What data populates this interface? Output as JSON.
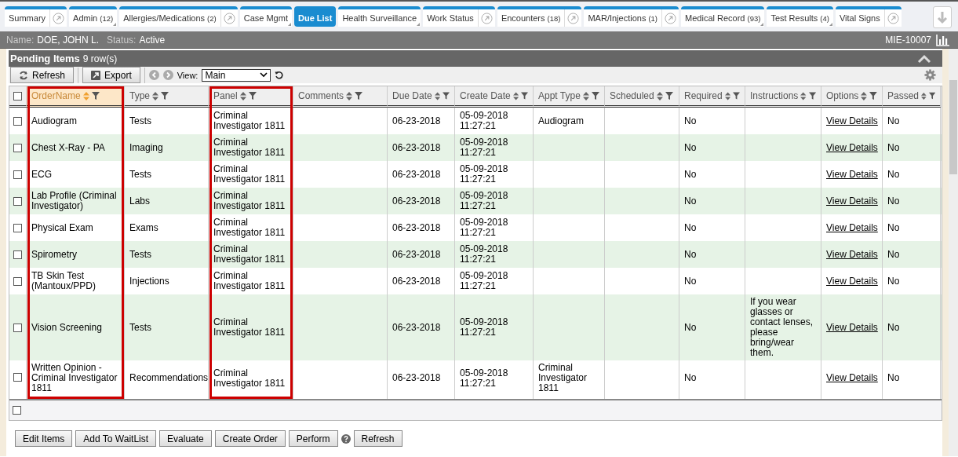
{
  "tabs": [
    {
      "label": "Summary",
      "selected": false,
      "link": true,
      "corner": false
    },
    {
      "label": "Admin",
      "count": "(12)",
      "selected": false,
      "link": false,
      "corner": true
    },
    {
      "label": "Allergies/Medications",
      "count": "(2)",
      "selected": false,
      "link": true,
      "corner": false
    },
    {
      "label": "Case Mgmt",
      "selected": false,
      "link": false,
      "corner": true
    },
    {
      "label": "Due List",
      "selected": true,
      "link": false,
      "corner": false
    },
    {
      "label": "Health Surveillance",
      "selected": false,
      "link": false,
      "corner": true
    },
    {
      "label": "Work Status",
      "selected": false,
      "link": true,
      "corner": false
    },
    {
      "label": "Encounters",
      "count": "(18)",
      "selected": false,
      "link": true,
      "corner": false
    },
    {
      "label": "MAR/Injections",
      "count": "(1)",
      "selected": false,
      "link": true,
      "corner": false
    },
    {
      "label": "Medical Record",
      "count": "(93)",
      "selected": false,
      "link": false,
      "corner": true
    },
    {
      "label": "Test Results",
      "count": "(4)",
      "selected": false,
      "link": false,
      "corner": true
    },
    {
      "label": "Vital Signs",
      "selected": false,
      "link": true,
      "corner": false
    }
  ],
  "patient": {
    "name_label": "Name:",
    "name": "DOE, JOHN L.",
    "status_label": "Status:",
    "status": "Active",
    "id": "MIE-10007"
  },
  "panel": {
    "title": "Pending Items",
    "row_count": "9 row(s)"
  },
  "toolbar": {
    "refresh": "Refresh",
    "export": "Export",
    "view_label": "View:",
    "view": "Main"
  },
  "table": {
    "columns": [
      {
        "label": "OrderName",
        "sorted": true,
        "highlighted": true
      },
      {
        "label": "Type",
        "sorted": false,
        "highlighted": false
      },
      {
        "label": "Panel",
        "sorted": false,
        "highlighted": true
      },
      {
        "label": "Comments",
        "sorted": false,
        "highlighted": false
      },
      {
        "label": "Due Date",
        "sorted": false,
        "highlighted": false
      },
      {
        "label": "Create Date",
        "sorted": false,
        "highlighted": false
      },
      {
        "label": "Appt Type",
        "sorted": false,
        "highlighted": false
      },
      {
        "label": "Scheduled",
        "sorted": false,
        "highlighted": false
      },
      {
        "label": "Required",
        "sorted": false,
        "highlighted": false
      },
      {
        "label": "Instructions",
        "sorted": false,
        "highlighted": false
      },
      {
        "label": "Options",
        "sorted": false,
        "highlighted": false
      },
      {
        "label": "Passed",
        "sorted": false,
        "highlighted": false
      }
    ],
    "rows": [
      {
        "checked": false,
        "cells": [
          "Audiogram",
          "Tests",
          "Criminal Investigator 1811",
          null,
          "06-23-2018",
          "05-09-2018 11:27:21",
          "Audiogram",
          null,
          "No",
          null,
          "View Details",
          "No"
        ]
      },
      {
        "checked": false,
        "cells": [
          "Chest X-Ray - PA",
          "Imaging",
          "Criminal Investigator 1811",
          null,
          "06-23-2018",
          "05-09-2018 11:27:21",
          null,
          null,
          "No",
          null,
          "View Details",
          "No"
        ]
      },
      {
        "checked": false,
        "cells": [
          "ECG",
          "Tests",
          "Criminal Investigator 1811",
          null,
          "06-23-2018",
          "05-09-2018 11:27:21",
          null,
          null,
          "No",
          null,
          "View Details",
          "No"
        ]
      },
      {
        "checked": false,
        "cells": [
          "Lab Profile (Criminal Investigator)",
          "Labs",
          "Criminal Investigator 1811",
          null,
          "06-23-2018",
          "05-09-2018 11:27:21",
          null,
          null,
          "No",
          null,
          "View Details",
          "No"
        ]
      },
      {
        "checked": false,
        "cells": [
          "Physical Exam",
          "Exams",
          "Criminal Investigator 1811",
          null,
          "06-23-2018",
          "05-09-2018 11:27:21",
          null,
          null,
          "No",
          null,
          "View Details",
          "No"
        ]
      },
      {
        "checked": false,
        "cells": [
          "Spirometry",
          "Tests",
          "Criminal Investigator 1811",
          null,
          "06-23-2018",
          "05-09-2018 11:27:21",
          null,
          null,
          "No",
          null,
          "View Details",
          "No"
        ]
      },
      {
        "checked": false,
        "cells": [
          "TB Skin Test (Mantoux/PPD)",
          "Injections",
          "Criminal Investigator 1811",
          null,
          "06-23-2018",
          "05-09-2018 11:27:21",
          null,
          null,
          "No",
          null,
          "View Details",
          "No"
        ]
      },
      {
        "checked": false,
        "cells": [
          "Vision Screening",
          "Tests",
          "Criminal Investigator 1811",
          null,
          "06-23-2018",
          "05-09-2018 11:27:21",
          null,
          null,
          "No",
          "If you wear glasses or contact lenses, please bring/wear them.",
          "View Details",
          "No"
        ]
      },
      {
        "checked": false,
        "cells": [
          "Written Opinion - Criminal Investigator 1811",
          "Recommendations",
          "Criminal Investigator 1811",
          null,
          "06-23-2018",
          "05-09-2018 11:27:21",
          "Criminal Investigator 1811",
          null,
          "No",
          null,
          "View Details",
          "No"
        ]
      }
    ],
    "select_all_checked": false,
    "footer_checked": false
  },
  "actions": [
    {
      "kind": "button",
      "label": "Edit Items"
    },
    {
      "kind": "button",
      "label": "Add To WaitList"
    },
    {
      "kind": "button",
      "label": "Evaluate"
    },
    {
      "kind": "button",
      "label": "Create Order"
    },
    {
      "kind": "button",
      "label": "Perform"
    },
    {
      "kind": "help"
    },
    {
      "kind": "button",
      "label": "Refresh"
    }
  ]
}
